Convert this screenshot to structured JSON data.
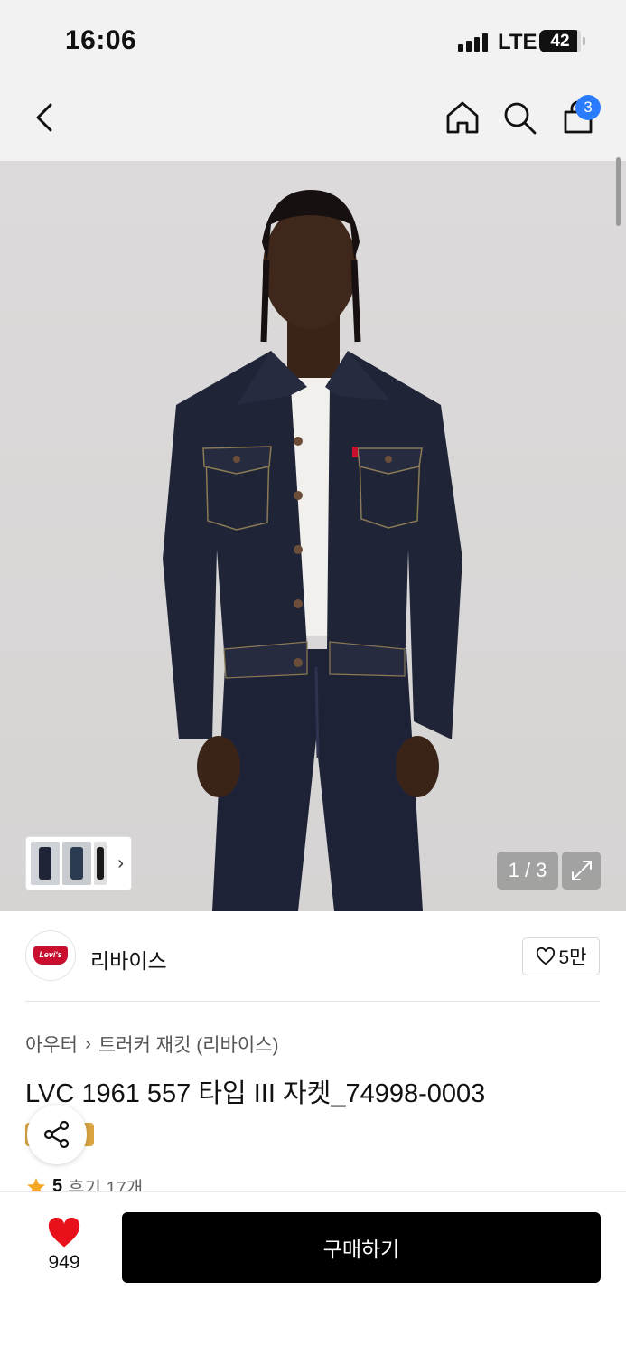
{
  "status_bar": {
    "time": "16:06",
    "network": "LTE",
    "battery": "42"
  },
  "nav": {
    "back_icon": "chevron-left-icon",
    "home_icon": "home-icon",
    "search_icon": "search-icon",
    "cart_icon": "shopping-bag-icon",
    "cart_count": "3"
  },
  "gallery": {
    "counter": "1 / 3",
    "thumbnails": 3,
    "expand_icon": "expand-icon"
  },
  "brand": {
    "logo_text": "Levi's",
    "name": "리바이스",
    "likes": "5만"
  },
  "product": {
    "breadcrumb": [
      "아우터",
      "트러커 재킷 (리바이스)"
    ],
    "title": "LVC 1961 557 타입 III 자켓_74998-0003",
    "rating_score": "5",
    "reviews": "후기 17개"
  },
  "bottom_bar": {
    "like_count": "949",
    "buy_label": "구매하기"
  },
  "colors": {
    "accent_badge": "#2b7bff",
    "heart": "#e8101b",
    "buy_button": "#000000",
    "star": "#f5a623",
    "brand_red": "#c8102e"
  }
}
